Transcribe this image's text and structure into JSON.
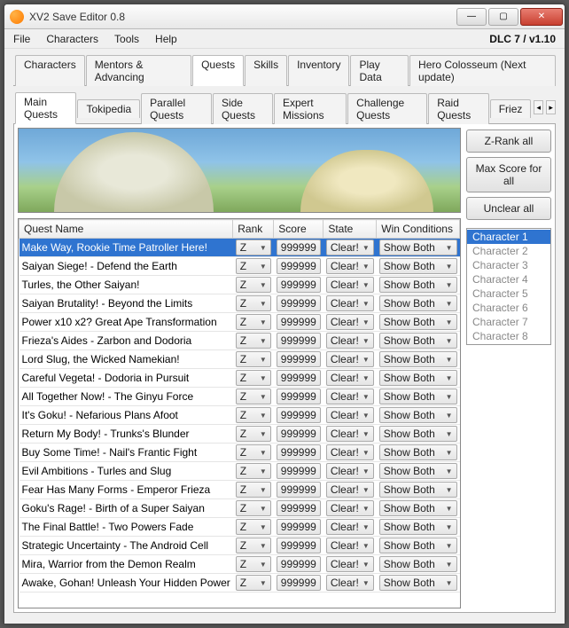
{
  "window": {
    "title": "XV2 Save Editor 0.8",
    "version": "DLC 7 / v1.10"
  },
  "menu": {
    "file": "File",
    "characters": "Characters",
    "tools": "Tools",
    "help": "Help"
  },
  "mainTabs": [
    {
      "label": "Characters"
    },
    {
      "label": "Mentors & Advancing"
    },
    {
      "label": "Quests"
    },
    {
      "label": "Skills"
    },
    {
      "label": "Inventory"
    },
    {
      "label": "Play Data"
    },
    {
      "label": "Hero Colosseum (Next update)"
    }
  ],
  "activeMainTab": "Quests",
  "subTabs": [
    {
      "label": "Main Quests"
    },
    {
      "label": "Tokipedia"
    },
    {
      "label": "Parallel Quests"
    },
    {
      "label": "Side Quests"
    },
    {
      "label": "Expert Missions"
    },
    {
      "label": "Challenge Quests"
    },
    {
      "label": "Raid Quests"
    },
    {
      "label": "Friez"
    }
  ],
  "activeSubTab": "Main Quests",
  "columns": {
    "questName": "Quest Name",
    "rank": "Rank",
    "score": "Score",
    "state": "State",
    "winConditions": "Win Conditions"
  },
  "rows": [
    {
      "name": "Make Way, Rookie Time Patroller Here!",
      "rank": "Z",
      "score": "999999",
      "state": "Clear!",
      "win": "Show Both",
      "selected": true
    },
    {
      "name": "Saiyan Siege! - Defend the Earth",
      "rank": "Z",
      "score": "999999",
      "state": "Clear!",
      "win": "Show Both"
    },
    {
      "name": "Turles, the Other Saiyan!",
      "rank": "Z",
      "score": "999999",
      "state": "Clear!",
      "win": "Show Both"
    },
    {
      "name": "Saiyan Brutality! - Beyond the Limits",
      "rank": "Z",
      "score": "999999",
      "state": "Clear!",
      "win": "Show Both"
    },
    {
      "name": "Power x10 x2? Great Ape Transformation",
      "rank": "Z",
      "score": "999999",
      "state": "Clear!",
      "win": "Show Both"
    },
    {
      "name": "Frieza's Aides - Zarbon and Dodoria",
      "rank": "Z",
      "score": "999999",
      "state": "Clear!",
      "win": "Show Both"
    },
    {
      "name": "Lord Slug, the Wicked Namekian!",
      "rank": "Z",
      "score": "999999",
      "state": "Clear!",
      "win": "Show Both"
    },
    {
      "name": "Careful Vegeta! - Dodoria in Pursuit",
      "rank": "Z",
      "score": "999999",
      "state": "Clear!",
      "win": "Show Both"
    },
    {
      "name": "All Together Now! - The Ginyu Force",
      "rank": "Z",
      "score": "999999",
      "state": "Clear!",
      "win": "Show Both"
    },
    {
      "name": "It's Goku! - Nefarious Plans Afoot",
      "rank": "Z",
      "score": "999999",
      "state": "Clear!",
      "win": "Show Both"
    },
    {
      "name": "Return My Body! - Trunks's Blunder",
      "rank": "Z",
      "score": "999999",
      "state": "Clear!",
      "win": "Show Both"
    },
    {
      "name": "Buy Some Time! - Nail's Frantic Fight",
      "rank": "Z",
      "score": "999999",
      "state": "Clear!",
      "win": "Show Both"
    },
    {
      "name": "Evil Ambitions - Turles and Slug",
      "rank": "Z",
      "score": "999999",
      "state": "Clear!",
      "win": "Show Both"
    },
    {
      "name": "Fear Has Many Forms - Emperor Frieza",
      "rank": "Z",
      "score": "999999",
      "state": "Clear!",
      "win": "Show Both"
    },
    {
      "name": "Goku's Rage! - Birth of a Super Saiyan",
      "rank": "Z",
      "score": "999999",
      "state": "Clear!",
      "win": "Show Both"
    },
    {
      "name": "The Final Battle! - Two Powers Fade",
      "rank": "Z",
      "score": "999999",
      "state": "Clear!",
      "win": "Show Both"
    },
    {
      "name": "Strategic Uncertainty - The Android Cell",
      "rank": "Z",
      "score": "999999",
      "state": "Clear!",
      "win": "Show Both"
    },
    {
      "name": "Mira, Warrior from the Demon Realm",
      "rank": "Z",
      "score": "999999",
      "state": "Clear!",
      "win": "Show Both"
    },
    {
      "name": "Awake, Gohan! Unleash Your Hidden Power",
      "rank": "Z",
      "score": "999999",
      "state": "Clear!",
      "win": "Show Both"
    }
  ],
  "sidebar": {
    "zrank": "Z-Rank all",
    "maxscore": "Max Score for all",
    "unclear": "Unclear all",
    "characters": [
      "Character 1",
      "Character 2",
      "Character 3",
      "Character 4",
      "Character 5",
      "Character 6",
      "Character 7",
      "Character 8"
    ],
    "selectedCharacter": "Character 1"
  }
}
